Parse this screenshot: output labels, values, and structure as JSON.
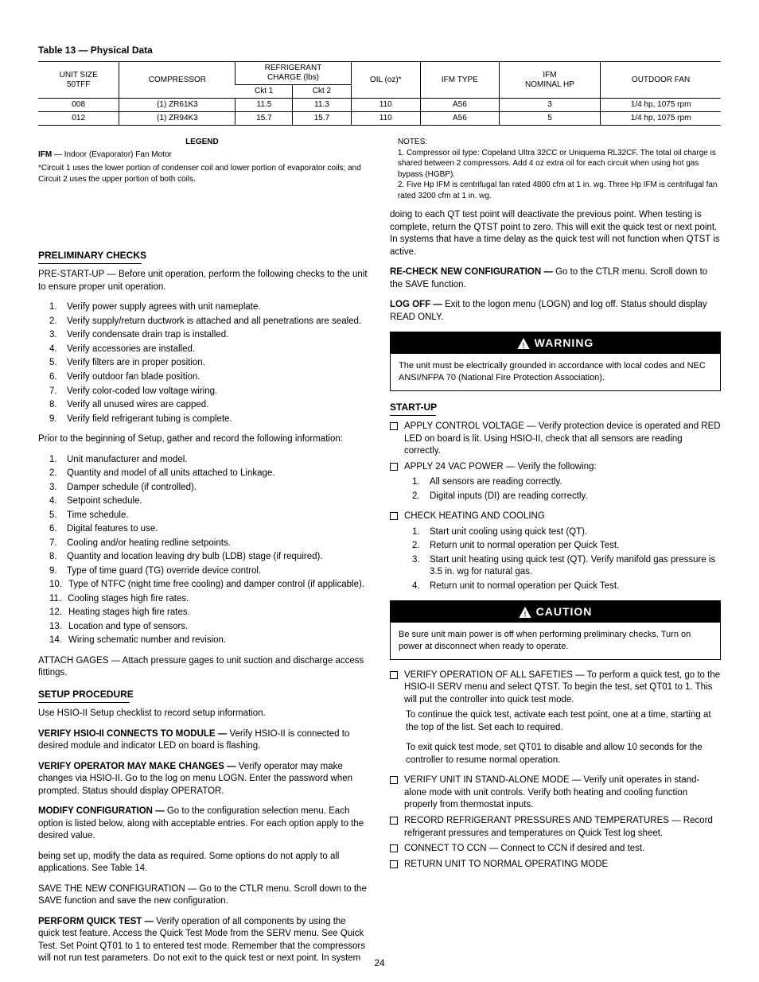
{
  "table_title": "Table 13 — Physical Data",
  "table": {
    "headers": {
      "unit_size": "UNIT SIZE\n50TFF",
      "compressor": "COMPRESSOR",
      "refrig_charge": "REFRIGERANT\nCHARGE (lbs)",
      "ckt1": "Ckt 1",
      "ckt2": "Ckt 2",
      "oil": "OIL (oz)*",
      "ifm_type": "IFM TYPE",
      "ifm_nom_hp": "IFM\nNOMINAL HP",
      "outdoor_fan": "OUTDOOR FAN"
    },
    "rows": [
      {
        "unit": "008",
        "compressor": "(1) ZR61K3",
        "ckt1": "11.5",
        "ckt2": "11.3",
        "oil": "110",
        "ifm_type": "A56",
        "ifm_nom_hp": "3",
        "outdoor_fan": "1/4 hp, 1075 rpm"
      },
      {
        "unit": "012",
        "compressor": "(1) ZR94K3",
        "ckt1": "15.7",
        "ckt2": "15.7",
        "oil": "110",
        "ifm_type": "A56",
        "ifm_nom_hp": "5",
        "outdoor_fan": "1/4 hp, 1075 rpm"
      }
    ]
  },
  "legend_label": "LEGEND",
  "legend_items": [
    {
      "abbr": "IFM",
      "def": "Indoor (Evaporator) Fan Motor"
    }
  ],
  "footnotes": [
    "*Circuit 1 uses the lower portion of condenser coil and lower portion of evaporator coils; and Circuit 2 uses the upper portion of both coils.",
    "NOTES:",
    "1. Compressor oil type: Copeland Ultra 32CC or Uniquema RL32CF. The total oil charge is shared between 2 compressors. Add 4 oz extra oil for each circuit when using hot gas bypass (HGBP).",
    "2. Five Hp IFM is centrifugal fan rated 4800 cfm at 1 in. wg. Three Hp IFM is centrifugal fan rated 3200 cfm at 1 in. wg."
  ],
  "section_prelim": "PRELIMINARY CHECKS",
  "prelim": {
    "p1": "PRE-START-UP — Before unit operation, perform the following checks to the unit to ensure proper unit operation.",
    "items": [
      "Verify power supply agrees with unit nameplate.",
      "Verify supply/return ductwork is attached and all penetrations are sealed.",
      "Verify condensate drain trap is installed.",
      "Verify accessories are installed.",
      "Verify filters are in proper position.",
      "Verify outdoor fan blade position.",
      "Verify color-coded low voltage wiring.",
      "Verify all unused wires are capped.",
      "Verify field refrigerant tubing is complete."
    ],
    "p2": "Prior to the beginning of Setup, gather and record the following information:",
    "items2": [
      "Unit manufacturer and model.",
      "Quantity and model of all units attached to Linkage.",
      "Damper schedule (if controlled).",
      "Setpoint schedule.",
      "Time schedule.",
      "Digital features to use.",
      "Cooling and/or heating redline setpoints.",
      "Quantity and location leaving dry bulb (LDB) stage (if required).",
      "Type of time guard (TG) override device control.",
      "Type of NTFC (night time free cooling) and damper control (if applicable).",
      "Cooling stages high fire rates.",
      "Heating stages high fire rates.",
      "Location and type of sensors.",
      "Wiring schematic number and revision."
    ],
    "p3": "ATTACH GAGES — Attach pressure gages to unit suction and discharge access fittings."
  },
  "section_setup": "SETUP PROCEDURE",
  "setup": {
    "p1": "Use HSIO-II Setup checklist to record setup information.",
    "p2_head": "VERIFY HSIO-II CONNECTS TO MODULE —",
    "p2": " Verify HSIO-II is connected to desired module and indicator LED on board is flashing.",
    "p3_head": "VERIFY OPERATOR MAY MAKE CHANGES —",
    "p3": " Verify operator may make changes via HSIO-II. Go to the log on menu LOGN. Enter the password when prompted. Status should display OPERATOR.",
    "p4_head": "MODIFY CONFIGURATION —",
    "p4": " Go to the configuration selection menu. Each option is listed below, along with acceptable entries. For each option apply to the desired value."
  },
  "col2": {
    "p1": "being set up, modify the data as required. Some options do not apply to all applications. See Table 14.",
    "p2": "SAVE THE NEW CONFIGURATION — Go to the CTLR menu. Scroll down to the SAVE function and save the new configuration.",
    "p3_head": "PERFORM QUICK TEST —",
    "p3": " Verify operation of all components by using the quick test feature. Access the Quick Test Mode from the SERV menu. See Quick Test. Set Point QT01 to 1 to entered test mode. Remember that the compressors will not run test parameters. Do not exit to the quick test or next point. In system doing to each QT test point will deactivate the previous point. When testing is complete, return the QTST point to zero. This will exit the quick test or next point. In systems that have a time delay as the quick test will not function when QTST is active.",
    "p4_head": "RE-CHECK NEW CONFIGURATION —",
    "p4": " Go to the CTLR menu. Scroll down to the SAVE function.",
    "p5_head": "LOG OFF —",
    "p5": " Exit to the logon menu (LOGN) and log off. Status should display READ ONLY."
  },
  "warning": {
    "label": "WARNING",
    "text": "The unit must be electrically grounded in accordance with local codes and NEC ANSI/NFPA 70 (National Fire Protection Association)."
  },
  "section_startup": "START-UP",
  "startup": {
    "p1": "APPLY CONTROL VOLTAGE — Verify protection device is operated and RED LED on board is lit. Using HSIO-II, check that all sensors are reading correctly.",
    "p2": "APPLY 24 VAC POWER — Verify the following:",
    "items": [
      "All sensors are reading correctly.",
      "Digital inputs (DI) are reading correctly."
    ],
    "p3_head": "CHECK HEATING AND COOLING",
    "p3_items": [
      "Start unit cooling using quick test (QT).",
      "Return unit to normal operation per Quick Test.",
      "Start unit heating using quick test (QT). Verify manifold gas pressure is 3.5 in. wg for natural gas.",
      "Return unit to normal operation per Quick Test."
    ]
  },
  "caution": {
    "label": "CAUTION",
    "text": "Be sure unit main power is off when performing preliminary checks. Turn on power at disconnect when ready to operate."
  },
  "post_caution": {
    "p1a": "VERIFY OPERATION OF ALL SAFETIES — ",
    "p1b": "To perform a quick test, go to the HSIO-II SERV menu and select QTST. To begin the test, set QT01 to 1. This will put the controller into quick test mode.",
    "p2": "To continue the quick test, activate each test point, one at a time, starting at the top of the list. Set each to required.",
    "p3": "To exit quick test mode, set QT01 to disable and allow 10 seconds for the controller to resume normal operation.",
    "p4": "VERIFY UNIT IN STAND-ALONE MODE — Verify unit operates in stand-alone mode with unit controls. Verify both heating and cooling function properly from thermostat inputs.",
    "p5": "RECORD REFRIGERANT PRESSURES AND TEMPERATURES — Record refrigerant pressures and temperatures on Quick Test log sheet.",
    "p6": "CONNECT TO CCN — Connect to CCN if desired and test.",
    "p7": "RETURN UNIT TO NORMAL OPERATING MODE"
  },
  "page_num": "24"
}
